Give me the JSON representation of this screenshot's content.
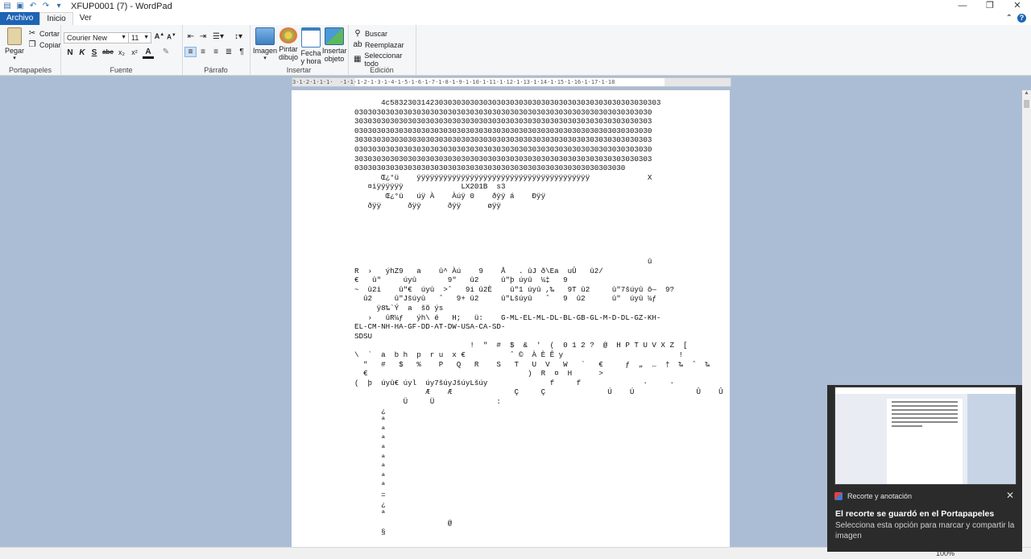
{
  "window": {
    "title": "XFUP0001 (7) - WordPad",
    "controls": {
      "minimize": "—",
      "maximize": "❐",
      "close": "✕"
    }
  },
  "tabs": [
    {
      "label": "Archivo"
    },
    {
      "label": "Inicio"
    },
    {
      "label": "Ver"
    }
  ],
  "ribbon": {
    "clipboard": {
      "group_label": "Portapapeles",
      "paste": "Pegar",
      "cut": "Cortar",
      "copy": "Copiar"
    },
    "font": {
      "group_label": "Fuente",
      "family": "Courier New",
      "size": "11",
      "bold": "N",
      "italic": "K",
      "underline": "S",
      "strike": "abc",
      "subscript": "x₂",
      "superscript": "x²"
    },
    "paragraph": {
      "group_label": "Párrafo"
    },
    "insert": {
      "group_label": "Insertar",
      "image": "Imagen",
      "paint1": "Pintar",
      "paint2": "dibujo",
      "date1": "Fecha",
      "date2": "y hora",
      "object1": "Insertar",
      "object2": "objeto"
    },
    "edit": {
      "group_label": "Edición",
      "find": "Buscar",
      "replace": "Reemplazar",
      "select_all": "Seleccionar todo"
    }
  },
  "ruler": {
    "ticks": "3·1·2·1·1·1·  ·1·1·1·2·1·3·1·4·1·5·1·6·1·7·1·8·1·9·1·10·1·11·1·12·1·13·1·14·1·15·1·16·1·17·1·18"
  },
  "document": {
    "lines": [
      "      4c5832303142303030303030303030303030303030303030303030303030303",
      "0303030303030303030303030303030303030303030303030303030303030303030",
      "3030303030303030303030303030303030303030303030303030303030303030303",
      "0303030303030303030303030303030303030303030303030303030303030303030",
      "3030303030303030303030303030303030303030303030303030303030303030303",
      "0303030303030303030303030303030303030303030303030303030303030303030",
      "3030303030303030303030303030303030303030303030303030303030303030303",
      "0303030303030303030303030303030303030303030303030303030303030     ",
      "      Œ¿°ü    ÿÿÿÿÿÿÿÿÿÿÿÿÿÿÿÿÿÿÿÿÿÿÿÿÿÿÿÿÿÿÿÿÿÿÿÿÿÿÿ             X",
      "   ¤iÿÿÿÿÿÿ             LX201B  s3",
      "       Œ¿°ü   úÿ À    Àúÿ 0    ðÿÿ á    Ðÿÿ",
      "   ðÿÿ      ðÿÿ      ðÿÿ      øÿÿ",
      "",
      "",
      "",
      "",
      "",
      "                                                                  û",
      "R  ›   ýhZ9   a    û^ Àú    9    Å   . ûJ ð\\Ea  uÛ   û2/",
      "€   û\"     úyû       9\"   û2     û\"þ úyû  ¼‡   9",
      "~  û2i    û\"€  úyû  >ˆ   9i û2È    û\"1 úyû ,‰   9T û2     û\"7šúyû ô—  9?",
      "  û2     û\"Jšúyû   ˆ   9+ û2     û\"Lšúyû   ˆ   9  û2      û\"  úyû ¼ƒ",
      "     ÿ8‰`Ý  a  šõ ýs",
      "   ›   ûR¼ƒ   ýh\\ é   H;   ü:    G-ML-EL-ML-DL-BL-GB-GL-M-D-DL-GZ-KH-",
      "EL-CM-NH-HA-GF-DD-AT-DW-USA-CA-SD-",
      "SDSU                                                              ",
      "                          !  \"  #  $  &  '  (  0 1 2 ?  @  H P T U V X Z  [",
      "\\  `  a  b h  p  r u  x €          ˆ ©  À È Ê y                          !",
      "  \"   #   $   %    P   Q   R    S   T   U  V   W   `   €     ƒ  „  …  †  ‰  ˆ  ‰",
      "  €                                    )  R  ¤  H      >",
      "(  þ  úyû€ úyl  úy7šúyJšúyLšúy              f     f              ·     ·",
      "                Æ    Æ              Ç     Ç              Ú    Ú              Û    Û",
      "           Ü     Ü              :",
      "      ¿",
      "      ª",
      "      ª",
      "      ª",
      "      ª",
      "      ª",
      "      ª",
      "      ª",
      "      ª",
      "      =",
      "      ¿",
      "      ª",
      "                     @",
      "      §"
    ]
  },
  "status": {
    "zoom": "100%"
  },
  "toast": {
    "app": "Recorte y anotación",
    "title": "El recorte se guardó en el Portapapeles",
    "body": "Selecciona esta opción para marcar y compartir la imagen"
  }
}
